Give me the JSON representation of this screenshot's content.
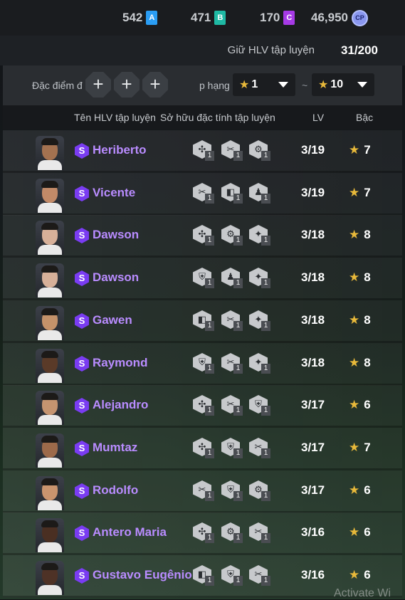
{
  "currencies": [
    {
      "value": "542",
      "token": "A",
      "color": "#2a9df4"
    },
    {
      "value": "471",
      "token": "B",
      "color": "#1fb9a4"
    },
    {
      "value": "170",
      "token": "C",
      "color": "#a63ae6"
    },
    {
      "value": "46,950",
      "token": "CP",
      "color": "#8a97f0"
    }
  ],
  "keep": {
    "label": "Giữ HLV tập luyện",
    "value": "31/200"
  },
  "filter": {
    "trait_label": "Đặc điểm đ",
    "plus_label": "+",
    "rank_label": "p hạng",
    "star": "★",
    "min": "1",
    "tilde": "~",
    "max": "10"
  },
  "headers": {
    "name": "Tên HLV tập luyện",
    "traits": "Sở hữu đặc tính tập luyện",
    "lv": "LV",
    "rank": "Bậc"
  },
  "coaches": [
    {
      "name": "Heriberto",
      "lv": "3/19",
      "rank": "7",
      "skin": "#a47250",
      "traits": [
        "✣",
        "✂",
        "⚙"
      ]
    },
    {
      "name": "Vicente",
      "lv": "3/19",
      "rank": "7",
      "skin": "#c28a68",
      "traits": [
        "✂",
        "◧",
        "♟"
      ]
    },
    {
      "name": "Dawson",
      "lv": "3/18",
      "rank": "8",
      "skin": "#d7b099",
      "traits": [
        "✣",
        "⚙",
        "✦"
      ]
    },
    {
      "name": "Dawson",
      "lv": "3/18",
      "rank": "8",
      "skin": "#d7b099",
      "traits": [
        "⛨",
        "♟",
        "✦"
      ]
    },
    {
      "name": "Gawen",
      "lv": "3/18",
      "rank": "8",
      "skin": "#c4926a",
      "traits": [
        "◧",
        "✂",
        "✦"
      ]
    },
    {
      "name": "Raymond",
      "lv": "3/18",
      "rank": "8",
      "skin": "#5a3a28",
      "traits": [
        "⛨",
        "✂",
        "✦"
      ]
    },
    {
      "name": "Alejandro",
      "lv": "3/17",
      "rank": "6",
      "skin": "#c59470",
      "traits": [
        "✣",
        "✂",
        "⛨"
      ]
    },
    {
      "name": "Mumtaz",
      "lv": "3/17",
      "rank": "7",
      "skin": "#9c6a4a",
      "traits": [
        "✣",
        "⛨",
        "✂"
      ]
    },
    {
      "name": "Rodolfo",
      "lv": "3/17",
      "rank": "6",
      "skin": "#c9946e",
      "traits": [
        "✂",
        "⛨",
        "⚙"
      ]
    },
    {
      "name": "Antero Maria",
      "lv": "3/16",
      "rank": "6",
      "skin": "#4a2f22",
      "traits": [
        "✣",
        "⚙",
        "✂"
      ]
    },
    {
      "name": "Gustavo Eugênio",
      "lv": "3/16",
      "rank": "6",
      "skin": "#4e3226",
      "traits": [
        "◧",
        "⛨",
        "✂"
      ]
    }
  ],
  "trait_level": "1",
  "watermark": "Activate Wi"
}
